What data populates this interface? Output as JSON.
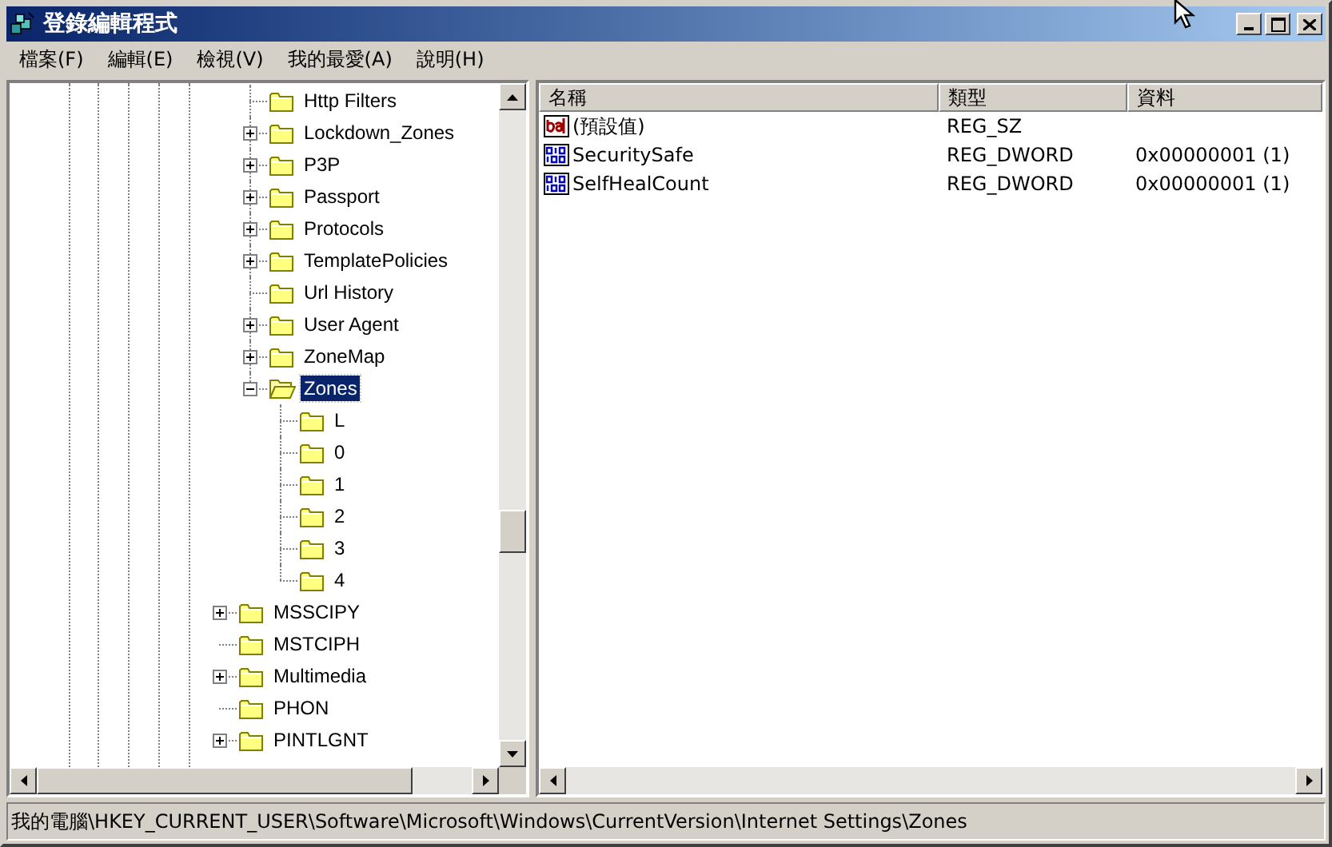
{
  "window": {
    "title": "登錄編輯程式"
  },
  "menu": [
    "檔案(F)",
    "編輯(E)",
    "檢視(V)",
    "我的最愛(A)",
    "說明(H)"
  ],
  "tree": {
    "items": [
      {
        "children": [
          {
            "label": "Http Filters",
            "expandable": false,
            "selected": false
          },
          {
            "label": "Lockdown_Zones",
            "expandable": true,
            "expanded": false,
            "selected": false
          },
          {
            "label": "P3P",
            "expandable": true,
            "expanded": false,
            "selected": false
          },
          {
            "label": "Passport",
            "expandable": true,
            "expanded": false,
            "selected": false
          },
          {
            "label": "Protocols",
            "expandable": true,
            "expanded": false,
            "selected": false
          },
          {
            "label": "TemplatePolicies",
            "expandable": true,
            "expanded": false,
            "selected": false
          },
          {
            "label": "Url History",
            "expandable": false,
            "selected": false
          },
          {
            "label": "User Agent",
            "expandable": true,
            "expanded": false,
            "selected": false
          },
          {
            "label": "ZoneMap",
            "expandable": true,
            "expanded": false,
            "selected": false
          },
          {
            "label": "Zones",
            "expandable": true,
            "expanded": true,
            "selected": true,
            "children": [
              {
                "label": "L",
                "expandable": false,
                "selected": false
              },
              {
                "label": "0",
                "expandable": false,
                "selected": false
              },
              {
                "label": "1",
                "expandable": false,
                "selected": false
              },
              {
                "label": "2",
                "expandable": false,
                "selected": false
              },
              {
                "label": "3",
                "expandable": false,
                "selected": false
              },
              {
                "label": "4",
                "expandable": false,
                "selected": false
              }
            ]
          }
        ]
      },
      {
        "label": "MSSCIPY",
        "expandable": true,
        "expanded": false,
        "selected": false
      },
      {
        "label": "MSTCIPH",
        "expandable": false,
        "selected": false
      },
      {
        "label": "Multimedia",
        "expandable": true,
        "expanded": false,
        "selected": false
      },
      {
        "label": "PHON",
        "expandable": false,
        "selected": false
      },
      {
        "label": "PINTLGNT",
        "expandable": true,
        "expanded": false,
        "selected": false
      }
    ]
  },
  "values": {
    "columns": [
      "名稱",
      "類型",
      "資料"
    ],
    "rows": [
      {
        "kind": "string",
        "name": "(預設值)",
        "type": "REG_SZ"
      },
      {
        "kind": "binary",
        "name": "SecuritySafe",
        "type": "REG_DWORD",
        "data": "0x00000001 (1)"
      },
      {
        "kind": "binary",
        "name": "SelfHealCount",
        "type": "REG_DWORD",
        "data": "0x00000001 (1)"
      }
    ]
  },
  "status_bar": "我的電腦\\HKEY_CURRENT_USER\\Software\\Microsoft\\Windows\\CurrentVersion\\Internet Settings\\Zones"
}
